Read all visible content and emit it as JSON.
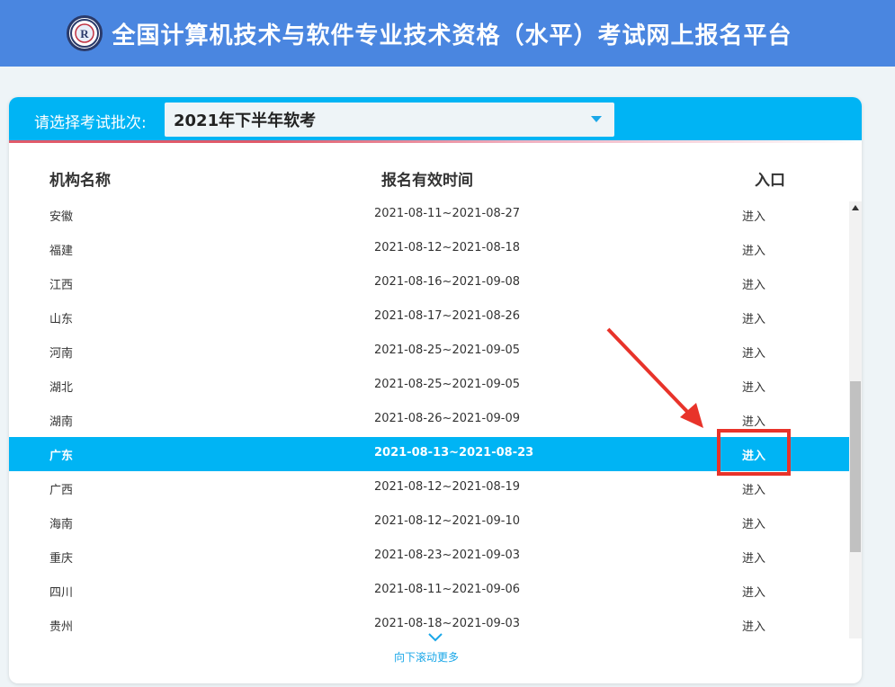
{
  "header": {
    "title": "全国计算机技术与软件专业技术资格（水平）考试网上报名平台"
  },
  "batch": {
    "label": "请选择考试批次:",
    "selected": "2021年下半年软考"
  },
  "table": {
    "columns": [
      "机构名称",
      "报名有效时间",
      "入口"
    ],
    "rows": [
      {
        "name": "安徽",
        "time": "2021-08-11~2021-08-27",
        "entry": "进入"
      },
      {
        "name": "福建",
        "time": "2021-08-12~2021-08-18",
        "entry": "进入"
      },
      {
        "name": "江西",
        "time": "2021-08-16~2021-09-08",
        "entry": "进入"
      },
      {
        "name": "山东",
        "time": "2021-08-17~2021-08-26",
        "entry": "进入"
      },
      {
        "name": "河南",
        "time": "2021-08-25~2021-09-05",
        "entry": "进入"
      },
      {
        "name": "湖北",
        "time": "2021-08-25~2021-09-05",
        "entry": "进入"
      },
      {
        "name": "湖南",
        "time": "2021-08-26~2021-09-09",
        "entry": "进入"
      },
      {
        "name": "广东",
        "time": "2021-08-13~2021-08-23",
        "entry": "进入"
      },
      {
        "name": "广西",
        "time": "2021-08-12~2021-08-19",
        "entry": "进入"
      },
      {
        "name": "海南",
        "time": "2021-08-12~2021-09-10",
        "entry": "进入"
      },
      {
        "name": "重庆",
        "time": "2021-08-23~2021-09-03",
        "entry": "进入"
      },
      {
        "name": "四川",
        "time": "2021-08-11~2021-09-06",
        "entry": "进入"
      },
      {
        "name": "贵州",
        "time": "2021-08-18~2021-09-03",
        "entry": "进入"
      }
    ],
    "selected_index": 7
  },
  "scroll_more": {
    "label": "向下滚动更多"
  },
  "colors": {
    "header_bg": "#4a86e0",
    "accent": "#00b4f4",
    "highlight_border": "#e8332a",
    "arrow": "#e8332a"
  },
  "icons": {
    "logo": "logo-seal-icon",
    "select_caret": "caret-down-icon",
    "scroll_chevron": "chevron-down-icon",
    "scroll_up": "scroll-up-arrow-icon",
    "annotation_arrow": "red-arrow-icon"
  }
}
